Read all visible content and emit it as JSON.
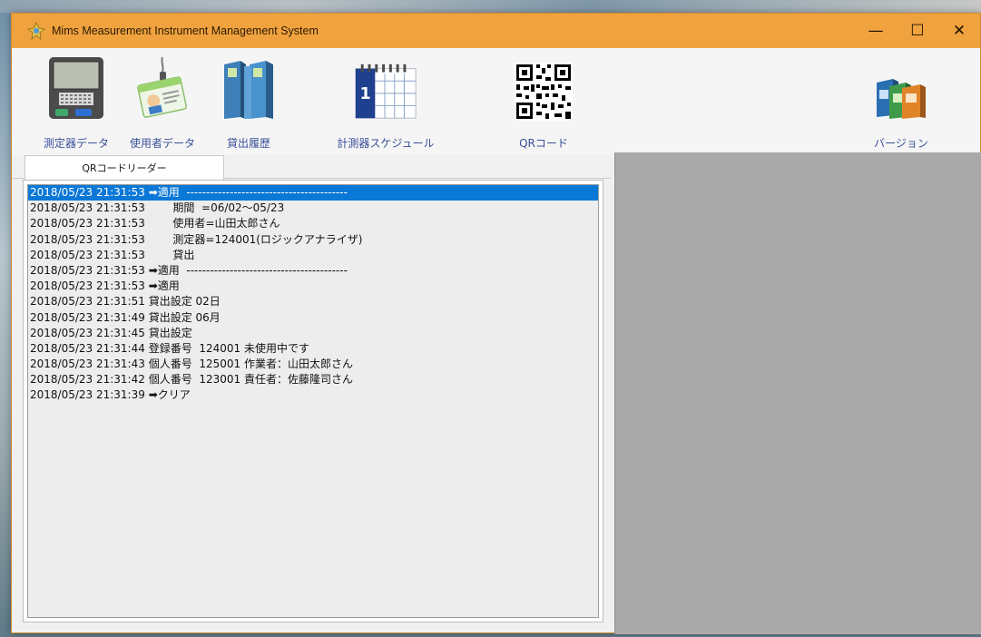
{
  "window": {
    "title": "Mims  Measurement Instrument Management System",
    "controls": {
      "minimize": "—",
      "maximize": "☐",
      "close": "✕"
    },
    "accent": "#f0a23f"
  },
  "toolbar": {
    "items": [
      {
        "id": "instrument-data",
        "label": "測定器データ",
        "icon": "handheld-terminal-icon"
      },
      {
        "id": "user-data",
        "label": "使用者データ",
        "icon": "id-badge-icon"
      },
      {
        "id": "loan-history",
        "label": "貸出履歴",
        "icon": "binders-icon"
      },
      {
        "id": "schedule",
        "label": "計測器スケジュール",
        "icon": "calendar-icon"
      },
      {
        "id": "qr-code",
        "label": "QRコード",
        "icon": "qr-code-icon"
      },
      {
        "id": "version",
        "label": "バージョン",
        "icon": "software-boxes-icon"
      }
    ]
  },
  "tabs": [
    {
      "label": "QRコードリーダー",
      "active": true
    }
  ],
  "log": {
    "selected_index": 0,
    "lines": [
      "2018/05/23 21:31:53 ➡適用  -----------------------------------------",
      "2018/05/23 21:31:53        期間  =06/02～05/23",
      "2018/05/23 21:31:53        使用者=山田太郎さん",
      "2018/05/23 21:31:53        測定器=124001(ロジックアナライザ)",
      "2018/05/23 21:31:53        貸出",
      "2018/05/23 21:31:53 ➡適用  -----------------------------------------",
      "2018/05/23 21:31:53 ➡適用",
      "2018/05/23 21:31:51 貸出設定 02日",
      "2018/05/23 21:31:49 貸出設定 06月",
      "2018/05/23 21:31:45 貸出設定",
      "2018/05/23 21:31:44 登録番号  124001 未使用中です",
      "2018/05/23 21:31:43 個人番号  125001 作業者：山田太郎さん",
      "2018/05/23 21:31:42 個人番号  123001 責任者：佐藤隆司さん",
      "2018/05/23 21:31:39 ➡クリア"
    ]
  }
}
